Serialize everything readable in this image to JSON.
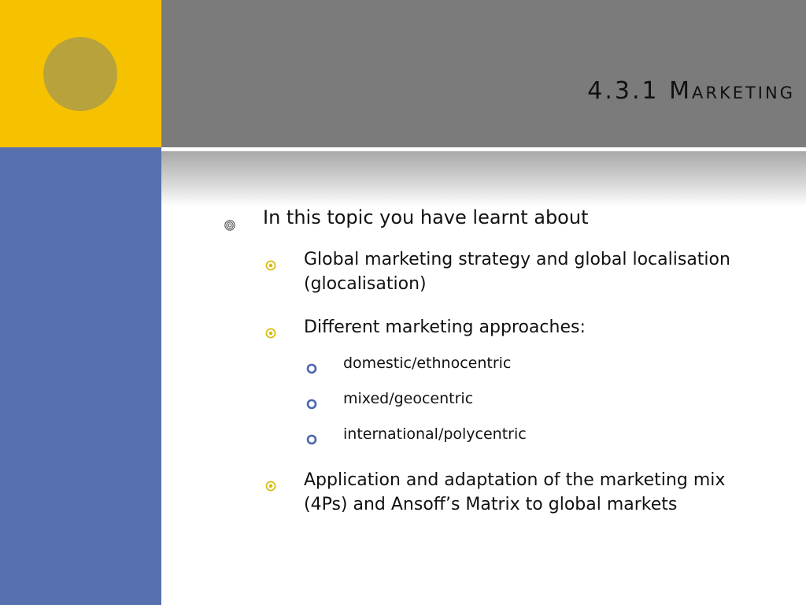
{
  "slide": {
    "title": "4.3.1 Marketing",
    "colors": {
      "yellow": "#f6c200",
      "circle": "#b8a23c",
      "blue": "#5670b0",
      "gray": "#7b7b7b",
      "bullet_yellow": "#d9b800",
      "bullet_blue": "#4a66b0"
    }
  },
  "content": {
    "intro": "In this topic you have learnt about",
    "points": [
      {
        "text": "Global marketing strategy and global localisation (glocalisation)"
      },
      {
        "text": "Different marketing approaches:"
      },
      {
        "text": "Application and adaptation of the marketing mix (4Ps) and Ansoff’s Matrix to global markets"
      }
    ],
    "approaches": [
      "domestic/ethnocentric",
      "mixed/geocentric",
      "international/polycentric"
    ],
    "icons": {
      "level1": "concentric-circle-bullet-icon",
      "level2": "target-bullet-icon",
      "level3": "ring-bullet-icon"
    }
  }
}
